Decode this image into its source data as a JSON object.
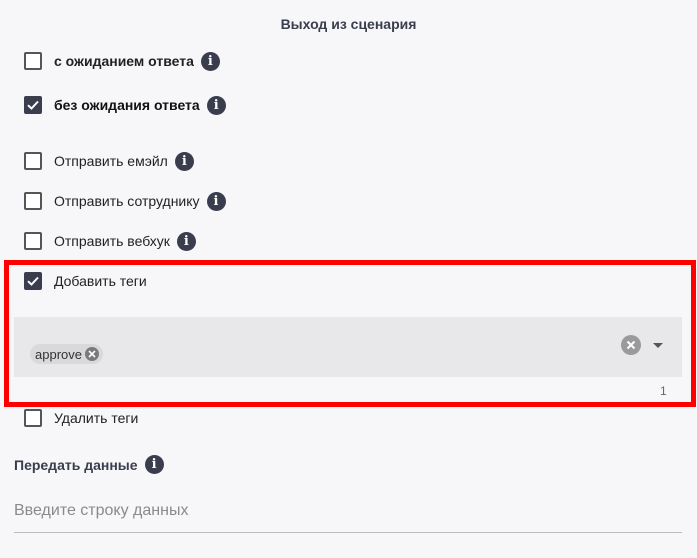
{
  "header": {
    "title": "Выход из сценария"
  },
  "options": {
    "with_wait": {
      "label": "с ожиданием ответа",
      "checked": false
    },
    "without_wait": {
      "label": "без ожидания ответа",
      "checked": true
    },
    "send_email": {
      "label": "Отправить емэйл",
      "checked": false
    },
    "send_employee": {
      "label": "Отправить сотруднику",
      "checked": false
    },
    "send_webhook": {
      "label": "Отправить вебхук",
      "checked": false
    },
    "add_tags": {
      "label": "Добавить теги",
      "checked": true
    },
    "remove_tags": {
      "label": "Удалить теги",
      "checked": false
    }
  },
  "tags_select": {
    "chips": [
      "approve"
    ],
    "counter": "1"
  },
  "pass_data": {
    "label": "Передать данные",
    "placeholder": "Введите строку данных",
    "value": ""
  },
  "icons": {
    "info": "i"
  },
  "colors": {
    "dark": "#3a3d4d",
    "highlight": "#ff0000"
  }
}
